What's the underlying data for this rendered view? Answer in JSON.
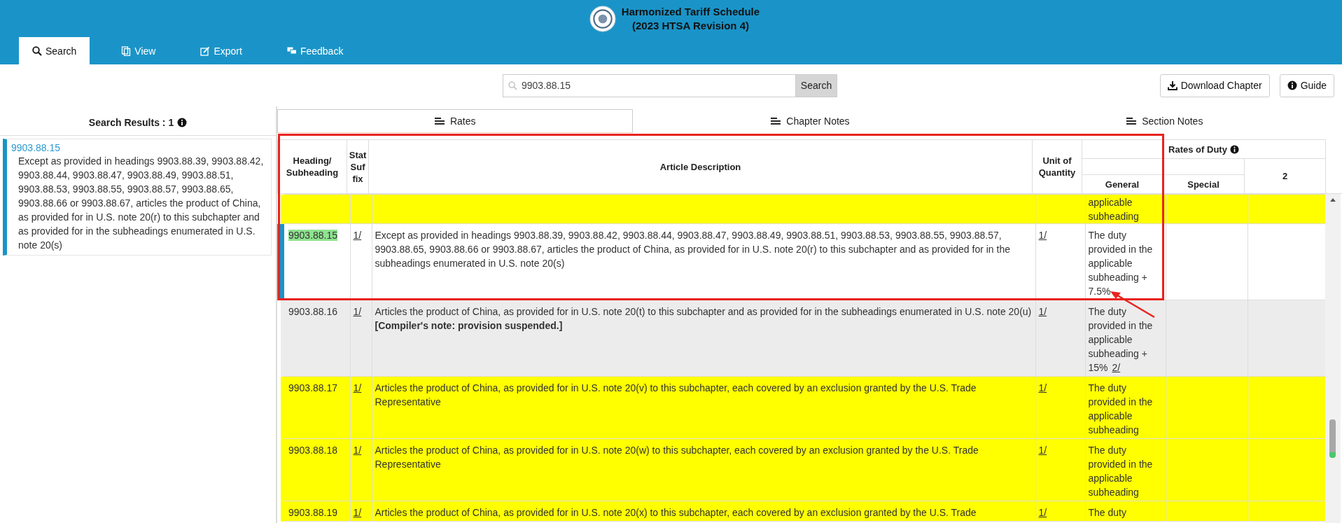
{
  "header": {
    "title_lines": [
      "Harmonized Tariff Schedule",
      "(2023 HTSA Revision 4)"
    ]
  },
  "nav_tabs": [
    {
      "label": "Search",
      "selected": true
    },
    {
      "label": "View",
      "selected": false
    },
    {
      "label": "Export",
      "selected": false
    },
    {
      "label": "Feedback",
      "selected": false
    }
  ],
  "search": {
    "value": "9903.88.15",
    "button": "Search"
  },
  "actions": [
    {
      "label": "Download Chapter"
    },
    {
      "label": "Guide"
    }
  ],
  "results": {
    "label": "Search Results : 1",
    "items": [
      {
        "heading": "9903.88.15",
        "description": "Except as provided in headings 9903.88.39, 9903.88.42, 9903.88.44, 9903.88.47, 9903.88.49, 9903.88.51, 9903.88.53, 9903.88.55, 9903.88.57, 9903.88.65, 9903.88.66 or 9903.88.67, articles the product of China, as provided for in U.S. note 20(r) to this subchapter and as provided for in the subheadings enumerated in U.S. note 20(s)",
        "selected": true
      }
    ]
  },
  "content_tabs": [
    {
      "label": "Rates",
      "selected": true
    },
    {
      "label": "Chapter Notes",
      "selected": false
    },
    {
      "label": "Section Notes",
      "selected": false
    }
  ],
  "table": {
    "columns": [
      "Heading/ Subheading",
      "Stat Suf fix",
      "Article Description",
      "Unit of Quantity"
    ],
    "rates_group": "Rates of Duty",
    "rates_columns": [
      "General",
      "Special",
      "2"
    ],
    "rows": [
      {
        "general": "applicable subheading",
        "color": "#ffff00",
        "selected": false
      },
      {
        "heading": "9903.88.15",
        "stat": "1/",
        "description": "Except as provided in headings 9903.88.39, 9903.88.42, 9903.88.44, 9903.88.47, 9903.88.49, 9903.88.51, 9903.88.53, 9903.88.55, 9903.88.57, 9903.88.65, 9903.88.66 or 9903.88.67, articles the product of China, as provided for in U.S. note 20(r) to this subchapter and as provided for in the subheadings enumerated in U.S. note 20(s)",
        "unit": "1/",
        "general": "The duty provided in the applicable subheading + 7.5%",
        "color": "#ffffff",
        "selected": true
      },
      {
        "heading": "9903.88.16",
        "stat": "1/",
        "description": "Articles the product of China, as provided for in U.S. note 20(t) to this subchapter and as provided for in the subheadings enumerated in U.S. note 20(u) **[Compiler's note: provision suspended.]**",
        "unit": "1/",
        "general": "The duty provided in the applicable subheading + 15%",
        "general_note": "2/",
        "color": "#ececec",
        "selected": false
      },
      {
        "heading": "9903.88.17",
        "stat": "1/",
        "description": "Articles the product of China, as provided for in U.S. note 20(v) to this subchapter, each covered by an exclusion granted by the U.S. Trade Representative",
        "unit": "1/",
        "general": "The duty provided in the applicable subheading",
        "color": "#ffff00",
        "selected": false
      },
      {
        "heading": "9903.88.18",
        "stat": "1/",
        "description": "Articles the product of China, as provided for in U.S. note 20(w) to this subchapter, each covered by an exclusion granted by the U.S. Trade Representative",
        "unit": "1/",
        "general": "The duty provided in the applicable subheading",
        "color": "#ffff00",
        "selected": false
      },
      {
        "heading": "9903.88.19",
        "stat": "1/",
        "description": "Articles the product of China, as provided for in U.S. note 20(x) to this subchapter, each covered by an exclusion granted by the U.S. Trade",
        "unit": "1/",
        "general": "The duty",
        "color": "#ffff00",
        "selected": false
      }
    ]
  }
}
